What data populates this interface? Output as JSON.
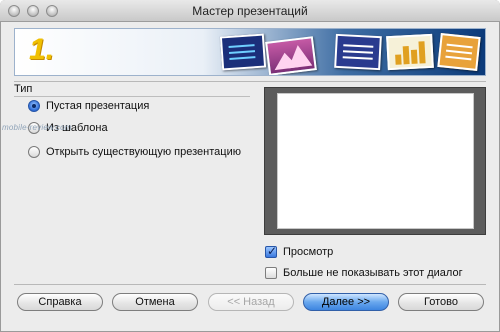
{
  "window": {
    "title": "Мастер презентаций"
  },
  "banner": {
    "step": "1.",
    "accent": "#f0c000"
  },
  "type_section": {
    "label": "Тип",
    "options": [
      {
        "label": "Пустая презентация",
        "selected": true
      },
      {
        "label": "Из шаблона",
        "selected": false
      },
      {
        "label": "Открыть существующую презентацию",
        "selected": false
      }
    ]
  },
  "watermark": "mobile-review.com",
  "preview": {
    "checkbox_label": "Просмотр",
    "checked": true
  },
  "dont_show": {
    "checkbox_label": "Больше не показывать этот диалог",
    "checked": false
  },
  "buttons": {
    "help": "Справка",
    "cancel": "Отмена",
    "back": "<< Назад",
    "next": "Далее >>",
    "finish": "Готово"
  }
}
